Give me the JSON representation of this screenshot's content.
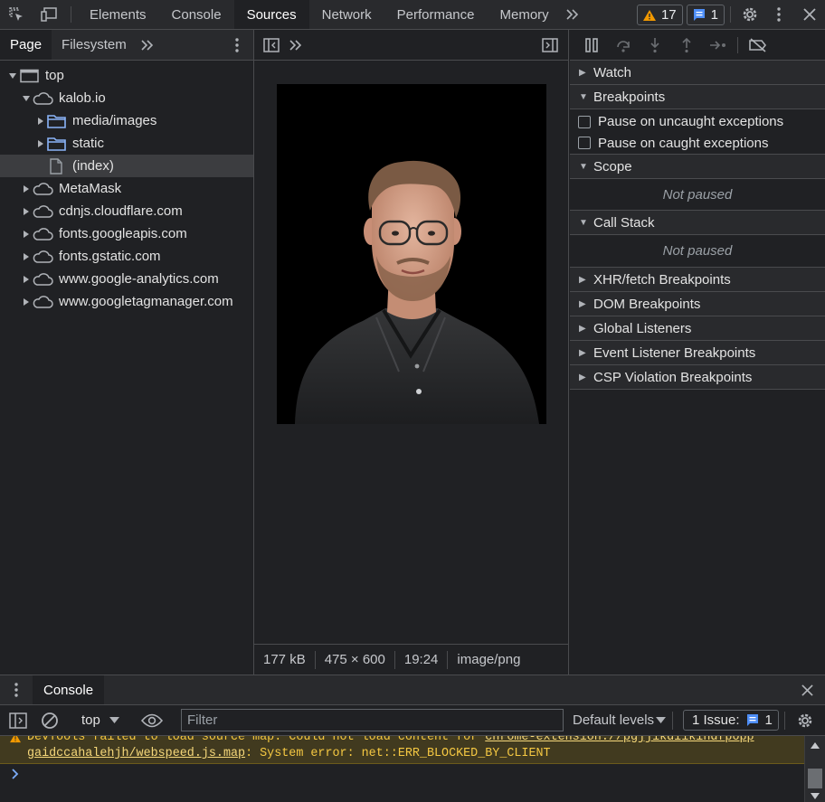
{
  "toolbar": {
    "tabs": [
      "Elements",
      "Console",
      "Sources",
      "Network",
      "Performance",
      "Memory"
    ],
    "active_tab": "Sources",
    "warnings_count": "17",
    "messages_count": "1"
  },
  "navigator": {
    "tabs": [
      "Page",
      "Filesystem"
    ],
    "tree": {
      "top": "top",
      "kalob": "kalob.io",
      "media": "media/images",
      "static": "static",
      "index": "(index)",
      "metamask": "MetaMask",
      "cdnjs": "cdnjs.cloudflare.com",
      "googleapis": "fonts.googleapis.com",
      "gstatic": "fonts.gstatic.com",
      "analytics": "www.google-analytics.com",
      "tagmanager": "www.googletagmanager.com"
    }
  },
  "preview": {
    "size": "177 kB",
    "dimensions": "475 × 600",
    "time": "19:24",
    "mime": "image/png"
  },
  "debugger": {
    "watch": "Watch",
    "breakpoints": "Breakpoints",
    "pause_uncaught": "Pause on uncaught exceptions",
    "pause_caught": "Pause on caught exceptions",
    "scope": "Scope",
    "scope_status": "Not paused",
    "call_stack": "Call Stack",
    "call_stack_status": "Not paused",
    "xhr": "XHR/fetch Breakpoints",
    "dom": "DOM Breakpoints",
    "global": "Global Listeners",
    "event": "Event Listener Breakpoints",
    "csp": "CSP Violation Breakpoints"
  },
  "drawer": {
    "tab": "Console",
    "context": "top",
    "filter_placeholder": "Filter",
    "levels": "Default levels",
    "issues_label": "1 Issue:",
    "issues_count": "1",
    "warning_line1_prefix": "DevTools failed to load source map: Could not load content for ",
    "warning_line1_link": "chrome-extension://pgjjikdiikihdfpopp",
    "warning_line2_link": "gaidccahalehjh/webspeed.js.map",
    "warning_line2_suffix": ": System error: net::ERR_BLOCKED_BY_CLIENT"
  },
  "colors": {
    "background": "#202124",
    "toolbar": "#292a2d",
    "folder": "#8ab4f8",
    "warning_text": "#f5c842",
    "warning_bg": "#413a1f"
  }
}
